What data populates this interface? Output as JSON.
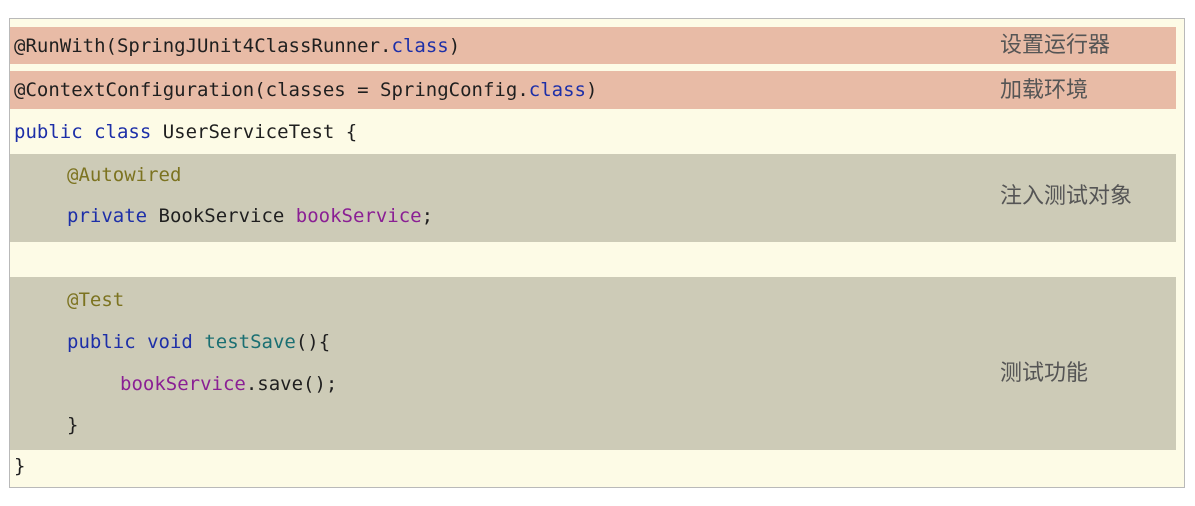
{
  "code": {
    "line1": {
      "annotation": "@RunWith(SpringJUnit4ClassRunner.",
      "class_kw": "class",
      "close": ")"
    },
    "line2": {
      "annotation": "@ContextConfiguration(classes = SpringConfig.",
      "class_kw": "class",
      "close": ")"
    },
    "line3": {
      "public_kw": "public",
      "class_kw": "class",
      "rest": " UserServiceTest {"
    },
    "line4": {
      "annotation": "@Autowired"
    },
    "line5": {
      "private_kw": "private",
      "type": " BookService ",
      "field": "bookService",
      "semi": ";"
    },
    "line6": {
      "annotation": "@Test"
    },
    "line7": {
      "public_kw": "public",
      "void_kw": "void",
      "method": "testSave",
      "paren": "(){"
    },
    "line8": {
      "field": "bookService",
      "call": ".save();"
    },
    "line9": {
      "brace": "}"
    },
    "line10": {
      "brace": "}"
    }
  },
  "notes": {
    "runner": "设置运行器",
    "env": "加载环境",
    "inject": "注入测试对象",
    "test": "测试功能"
  },
  "colors": {
    "annotation_band": "#e8bba6",
    "gray_band": "#cdcbb7",
    "background": "#fdfbe6",
    "keyword": "#1d2fa8",
    "annotation": "#7c7320",
    "field": "#8a1f94",
    "method": "#1a6f72"
  }
}
